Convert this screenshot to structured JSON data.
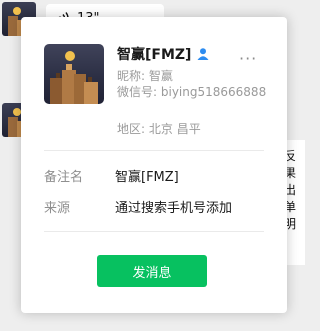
{
  "background_chat": {
    "voice_message": {
      "icon": "voice-icon",
      "duration": "13\""
    },
    "right_message_chars": [
      "反",
      "果",
      "出",
      "单",
      "明"
    ]
  },
  "profile": {
    "name": "智赢[FMZ]",
    "nickname_label": "昵称:",
    "nickname": "智赢",
    "wechat_id_label": "微信号:",
    "wechat_id": "biying518666888",
    "region_label": "地区:",
    "region": "北京 昌平",
    "more_label": "···",
    "remark_label": "备注名",
    "remark": "智赢[FMZ]",
    "source_label": "来源",
    "source": "通过搜索手机号添加",
    "send_button_label": "发消息"
  },
  "colors": {
    "accent_green": "#07c160",
    "contact_icon_blue": "#2d8cf0",
    "secondary_text": "#9a9a9a"
  },
  "icons": {
    "contact": "person-icon",
    "more": "more-icon"
  }
}
